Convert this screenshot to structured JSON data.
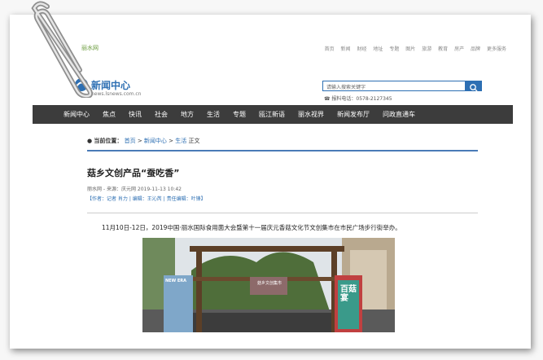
{
  "topbar": {
    "brand": "丽水网",
    "links": [
      "首页",
      "新闻",
      "财经",
      "地址",
      "专题",
      "图片",
      "旅游",
      "教育",
      "房产",
      "品牌",
      "更多服务"
    ]
  },
  "header": {
    "logo_title": "新闻中心",
    "logo_url": "news.lsnews.com.cn",
    "search_placeholder": "请输入搜索关键字",
    "phone": "报料电话：0578-2127345"
  },
  "nav": {
    "items": [
      "新闻中心",
      "焦点",
      "快讯",
      "社会",
      "地方",
      "生活",
      "专题",
      "瓯江新语",
      "丽水视界",
      "新闻发布厅",
      "问政直通车"
    ]
  },
  "breadcrumb": {
    "label": "当前位置：",
    "home": "首页",
    "sep1": ">",
    "center": "新闻中心",
    "sep2": ">",
    "life": "生活",
    "current": "正文"
  },
  "article": {
    "title": "菇乡文创产品“蚕吃香”",
    "meta": "丽水网 - 来源：庆元网    2019-11-13 10:42",
    "authors": "【作者：记者 肖力 | 编辑：王沁芮 | 责任编辑：叶锋】",
    "lead": "11月10日-12日，2019中国·丽水国际食用菌大会暨第十一届庆元香菇文化节文创集市在市民广场步行街举办。"
  },
  "photo": {
    "sign": "菇乡文创集市",
    "banner_left": "NEW ERA",
    "banner_right": "百菇宴"
  }
}
